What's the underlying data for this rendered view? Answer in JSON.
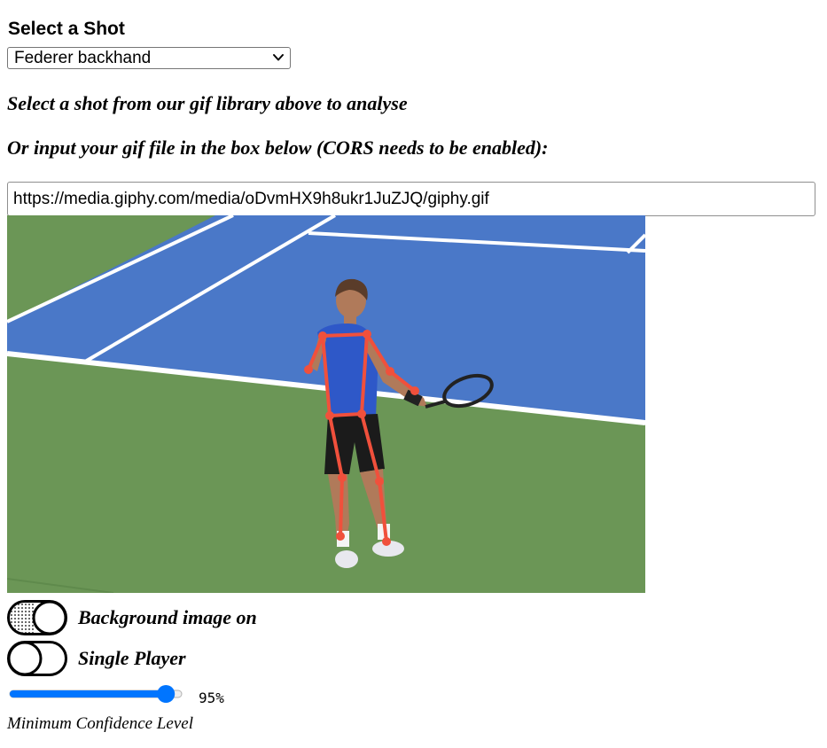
{
  "shot_select": {
    "heading": "Select a Shot",
    "selected": "Federer backhand"
  },
  "instructions": {
    "line1": "Select a shot from our gif library above to analyse",
    "line2": "Or input your gif file in the box below (CORS needs to be enabled):"
  },
  "gif_input": {
    "value": "https://media.giphy.com/media/oDvmHX9h8ukr1JuZJQ/giphy.gif"
  },
  "toggles": [
    {
      "label": "Background image on",
      "state": "on"
    },
    {
      "label": "Single Player",
      "state": "off"
    }
  ],
  "confidence": {
    "value_text": "95%",
    "value": 0.95,
    "caption": "Minimum Confidence Level"
  },
  "colors": {
    "court_blue": "#4a78c8",
    "court_green": "#6b9656",
    "skeleton": "#f0503c",
    "slider_accent": "#0075ff"
  },
  "icons": {
    "select_arrow": "chevron-down-icon"
  }
}
